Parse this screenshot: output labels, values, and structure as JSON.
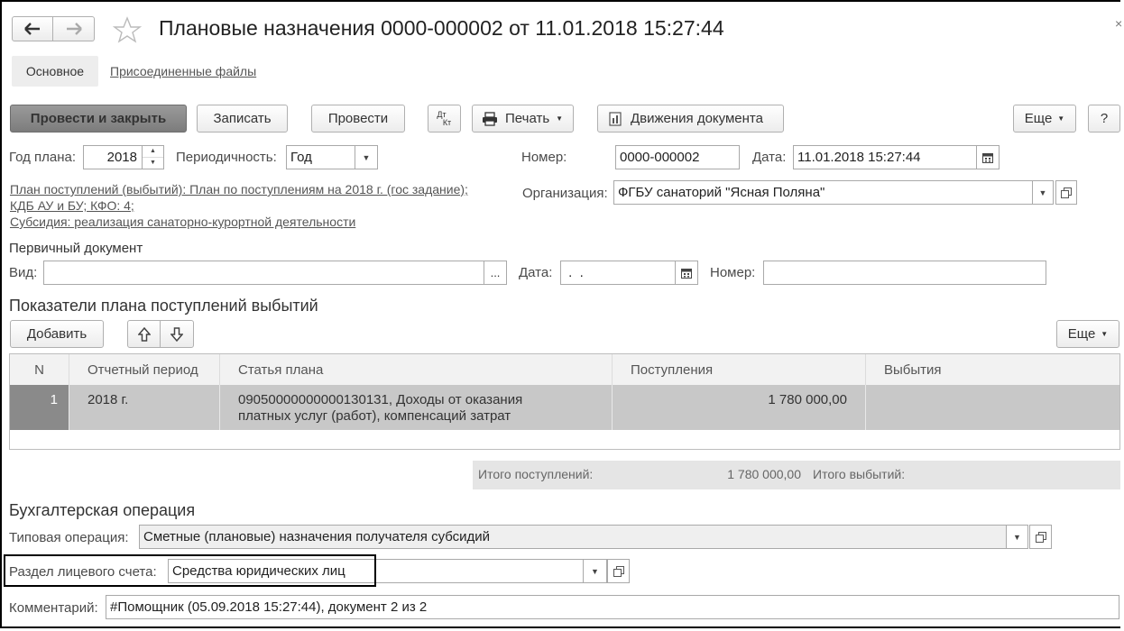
{
  "header": {
    "title": "Плановые назначения 0000-000002 от 11.01.2018 15:27:44",
    "tabs": [
      "Основное",
      "Присоединенные файлы"
    ]
  },
  "toolbar": {
    "post_close": "Провести и закрыть",
    "save": "Записать",
    "post": "Провести",
    "dtkt_top": "Дт",
    "dtkt_bottom": "Кт",
    "print": "Печать",
    "movements": "Движения документа",
    "more": "Еще",
    "help": "?"
  },
  "form": {
    "year_label": "Год плана:",
    "year_value": "2018",
    "periodicity_label": "Периодичность:",
    "periodicity_value": "Год",
    "number_label": "Номер:",
    "number_value": "0000-000002",
    "date_label": "Дата:",
    "date_value": "11.01.2018 15:27:44",
    "plan_link_line1": "План поступлений (выбытий): План по поступлениям на 2018 г. (гос задание);",
    "plan_link_line2": "КДБ АУ и БУ; КФО: 4;",
    "plan_link_line3": "Субсидия: реализация санаторно-курортной деятельности",
    "org_label": "Организация:",
    "org_value": "ФГБУ санаторий \"Ясная Поляна\""
  },
  "primary_doc": {
    "title": "Первичный документ",
    "kind_label": "Вид:",
    "kind_value": "",
    "kind_btn": "...",
    "date_label": "Дата:",
    "date_value": " .  .",
    "number_label": "Номер:",
    "number_value": ""
  },
  "indicators": {
    "title": "Показатели плана поступлений выбытий",
    "add": "Добавить",
    "more": "Еще",
    "columns": [
      "N",
      "Отчетный период",
      "Статья плана",
      "Поступления",
      "Выбытия"
    ],
    "rows": [
      {
        "n": "1",
        "period": "2018 г.",
        "article_line1": "09050000000000130131, Доходы от оказания",
        "article_line2": "платных услуг (работ), компенсаций затрат",
        "income": "1 780 000,00",
        "outcome": ""
      }
    ],
    "total_income_label": "Итого поступлений:",
    "total_income_value": "1 780 000,00",
    "total_outcome_label": "Итого выбытий:",
    "total_outcome_value": ""
  },
  "accounting": {
    "title": "Бухгалтерская операция",
    "typical_label": "Типовая операция:",
    "typical_value": "Сметные (плановые) назначения получателя субсидий",
    "section_label": "Раздел лицевого счета:",
    "section_value": "Средства юридических лиц",
    "comment_label": "Комментарий:",
    "comment_value": "#Помощник (05.09.2018 15:27:44), документ 2 из 2"
  },
  "window": {
    "close": "×"
  }
}
